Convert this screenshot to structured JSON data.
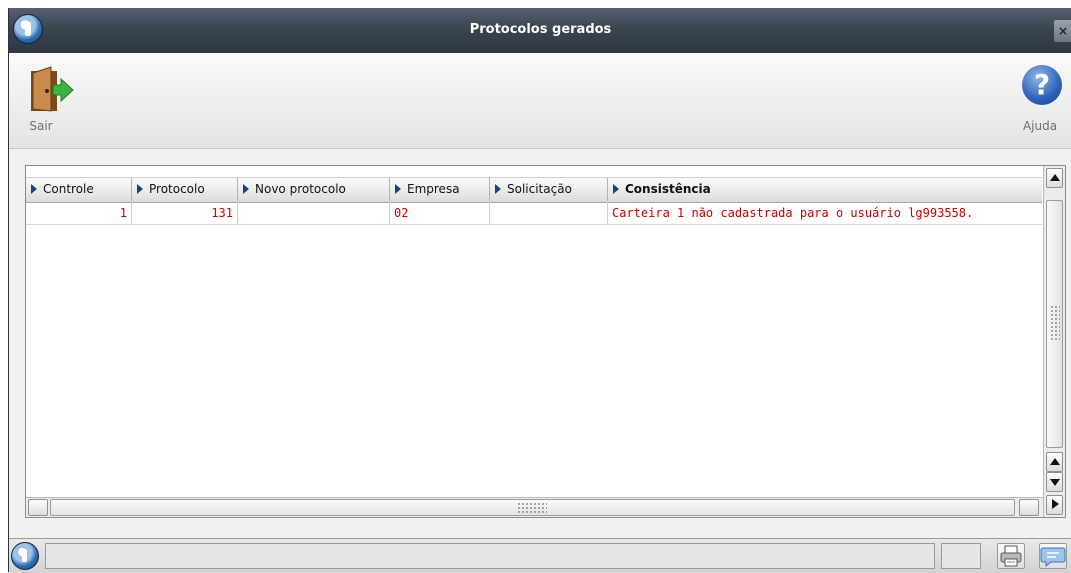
{
  "window": {
    "title": "Protocolos gerados",
    "close_label": "×"
  },
  "toolbar": {
    "exit_label": "Sair",
    "help_label": "Ajuda",
    "help_glyph": "?"
  },
  "grid": {
    "columns": [
      "Controle",
      "Protocolo",
      "Novo protocolo",
      "Empresa",
      "Solicitação",
      "Consistência"
    ],
    "rows": [
      {
        "controle": "1",
        "protocolo": "131",
        "novo_protocolo": "",
        "empresa": "02",
        "solicitacao": "",
        "consistencia": "Carteira 1 não cadastrada para o usuário lg993558."
      }
    ]
  },
  "colors": {
    "title_bar": "#3b4552",
    "row_text": "#cc0000",
    "header_arrow": "#1d3f8a",
    "help_icon": "#2d62b8"
  },
  "icons": [
    "app-logo-icon",
    "exit-door-icon",
    "help-icon",
    "printer-icon",
    "chat-icon"
  ]
}
